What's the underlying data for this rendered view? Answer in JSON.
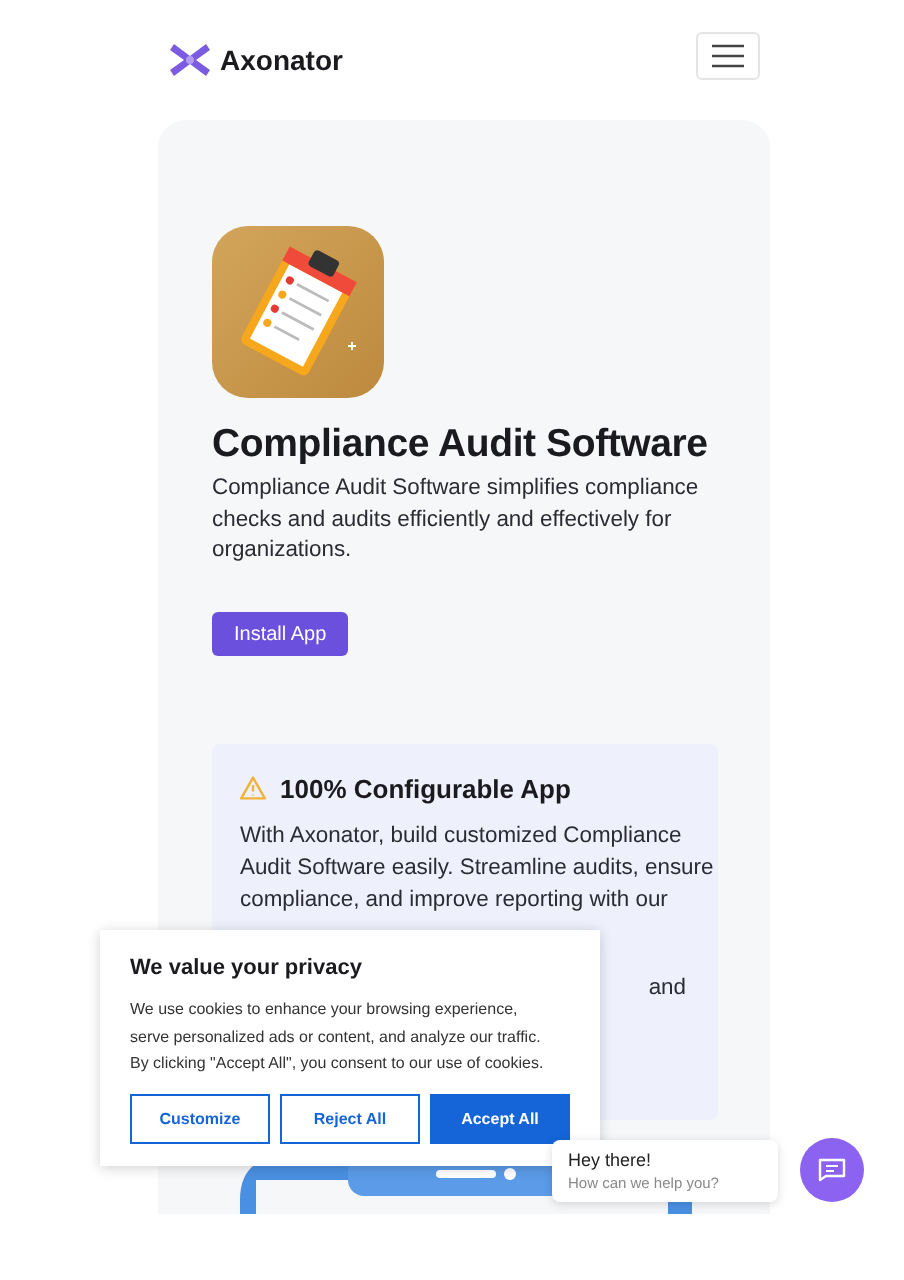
{
  "header": {
    "brand": "Axonator"
  },
  "hero": {
    "title": "Compliance Audit Software",
    "description": [
      "Compliance Audit Software simplifies compliance",
      "checks and audits efficiently and effectively for",
      "organizations."
    ],
    "button": "Install App"
  },
  "feature": {
    "title": "100% Configurable App",
    "lines": [
      "With Axonator, build customized Compliance",
      "Audit Software easily. Streamline audits, ensure",
      "compliance, and improve reporting with our"
    ],
    "tail": "and"
  },
  "cookie_banner": {
    "title": "We value your privacy",
    "lines": [
      "We use cookies to enhance your browsing experience,",
      "serve personalized ads or content, and analyze our traffic.",
      "By clicking \"Accept All\", you consent to our use of cookies."
    ],
    "buttons": [
      {
        "label": "Customize",
        "kind": "outline"
      },
      {
        "label": "Reject All",
        "kind": "outline"
      },
      {
        "label": "Accept All",
        "kind": "primary"
      }
    ]
  },
  "chat": {
    "title": "Hey there!",
    "subtitle": "How can we help you?"
  }
}
